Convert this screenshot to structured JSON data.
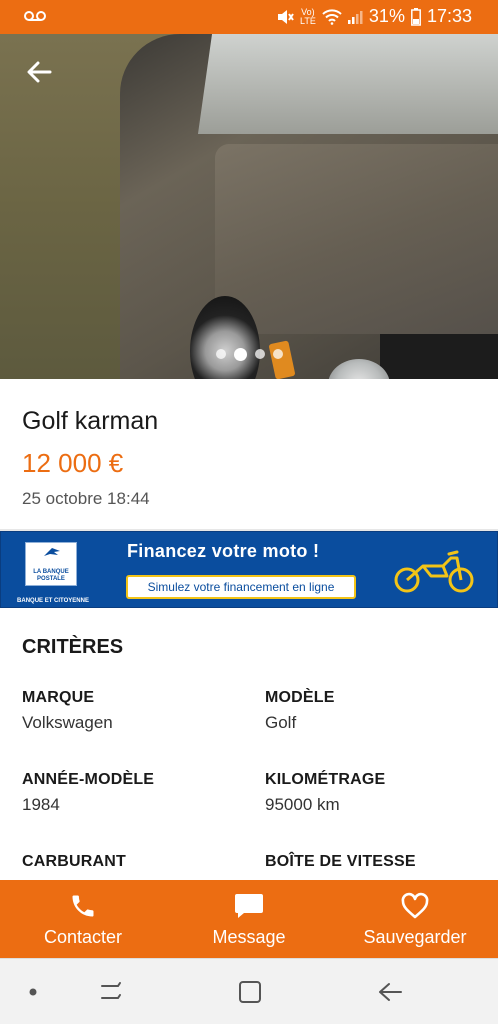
{
  "status_bar": {
    "battery_percent": "31%",
    "time": "17:33",
    "network_label": "Vo) LTE",
    "icons": [
      "voicemail-icon",
      "mute-icon",
      "wifi-icon",
      "signal-icon",
      "battery-icon"
    ]
  },
  "listing": {
    "title": "Golf karman",
    "price": "12 000 €",
    "date": "25 octobre 18:44",
    "gallery": {
      "dot_count": 4,
      "active_dot": 1
    }
  },
  "ad": {
    "bank_name": "LA BANQUE POSTALE",
    "bank_tagline": "BANQUE ET CITOYENNE",
    "headline": "Financez votre moto !",
    "cta": "Simulez votre financement en ligne",
    "colors": {
      "background": "#0a4d9e",
      "accent": "#f3c417"
    }
  },
  "criteria": {
    "heading": "CRITÈRES",
    "items": [
      {
        "label": "MARQUE",
        "value": "Volkswagen"
      },
      {
        "label": "MODÈLE",
        "value": "Golf"
      },
      {
        "label": "ANNÉE-MODÈLE",
        "value": "1984"
      },
      {
        "label": "KILOMÉTRAGE",
        "value": "95000 km"
      },
      {
        "label": "CARBURANT",
        "value": ""
      },
      {
        "label": "BOÎTE DE VITESSE",
        "value": ""
      }
    ]
  },
  "actions": {
    "contact": "Contacter",
    "message": "Message",
    "save": "Sauvegarder"
  },
  "colors": {
    "brand": "#ec6d12"
  }
}
